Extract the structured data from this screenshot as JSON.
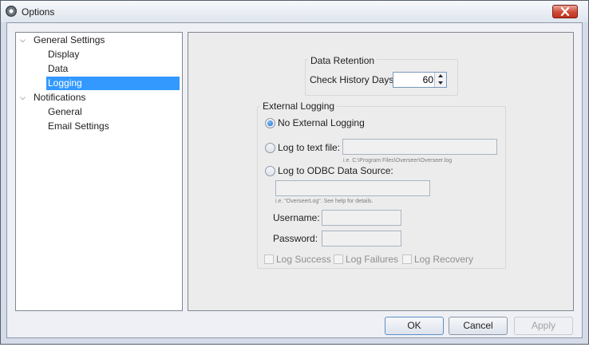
{
  "window": {
    "title": "Options"
  },
  "tree": {
    "general_settings": "General Settings",
    "display": "Display",
    "data": "Data",
    "logging": "Logging",
    "notifications": "Notifications",
    "general": "General",
    "email_settings": "Email Settings"
  },
  "data_retention": {
    "legend": "Data Retention",
    "check_history_label": "Check History Days:",
    "check_history_value": "60"
  },
  "external_logging": {
    "legend": "External Logging",
    "no_external": "No External Logging",
    "log_text_file": "Log to text file:",
    "text_file_value": "",
    "text_file_hint": "i.e. C:\\Program Files\\Overseer\\Overseer.log",
    "log_odbc": "Log to ODBC Data Source:",
    "odbc_value": "",
    "odbc_hint": "i.e. \"OverseerLog\". See help for details.",
    "username_label": "Username:",
    "username_value": "",
    "password_label": "Password:",
    "password_value": "",
    "log_success": "Log Success",
    "log_failures": "Log Failures",
    "log_recovery": "Log Recovery"
  },
  "buttons": {
    "ok": "OK",
    "cancel": "Cancel",
    "apply": "Apply"
  },
  "colors": {
    "selection": "#3399ff",
    "close": "#c0321f"
  }
}
